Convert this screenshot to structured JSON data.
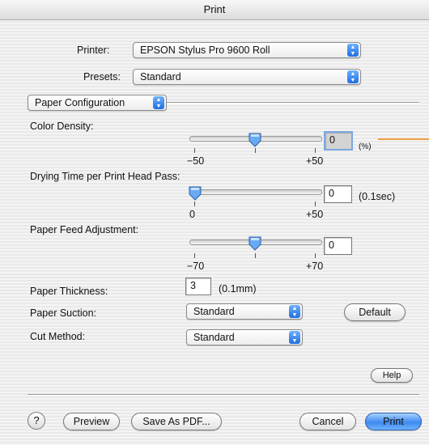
{
  "window": {
    "title": "Print"
  },
  "printer": {
    "label": "Printer:",
    "value": "EPSON Stylus Pro 9600 Roll"
  },
  "presets": {
    "label": "Presets:",
    "value": "Standard"
  },
  "panel": {
    "value": "Paper Configuration"
  },
  "color_density": {
    "label": "Color Density:",
    "min": "−50",
    "max": "+50",
    "value": "0",
    "unit": "(%)",
    "level": 0.5
  },
  "drying_time": {
    "label": "Drying Time per Print Head Pass:",
    "min": "0",
    "max": "+50",
    "value": "0",
    "unit": "(0.1sec)",
    "level": 0.0
  },
  "paper_feed": {
    "label": "Paper Feed Adjustment:",
    "min": "−70",
    "max": "+70",
    "value": "0",
    "level": 0.5
  },
  "paper_thickness": {
    "label": "Paper Thickness:",
    "value": "3",
    "unit": "(0.1mm)"
  },
  "paper_suction": {
    "label": "Paper Suction:",
    "value": "Standard"
  },
  "cut_method": {
    "label": "Cut Method:",
    "value": "Standard"
  },
  "buttons": {
    "default": "Default",
    "help": "Help",
    "help_icon": "?",
    "preview": "Preview",
    "save_pdf": "Save As PDF...",
    "cancel": "Cancel",
    "print": "Print"
  },
  "icons": {
    "popup_arrows": "updown-arrows-icon",
    "slider_thumb": "slider-thumb-icon"
  },
  "colors": {
    "accent_blue": "#3d8af0",
    "annotation_line": "#f0a040"
  }
}
